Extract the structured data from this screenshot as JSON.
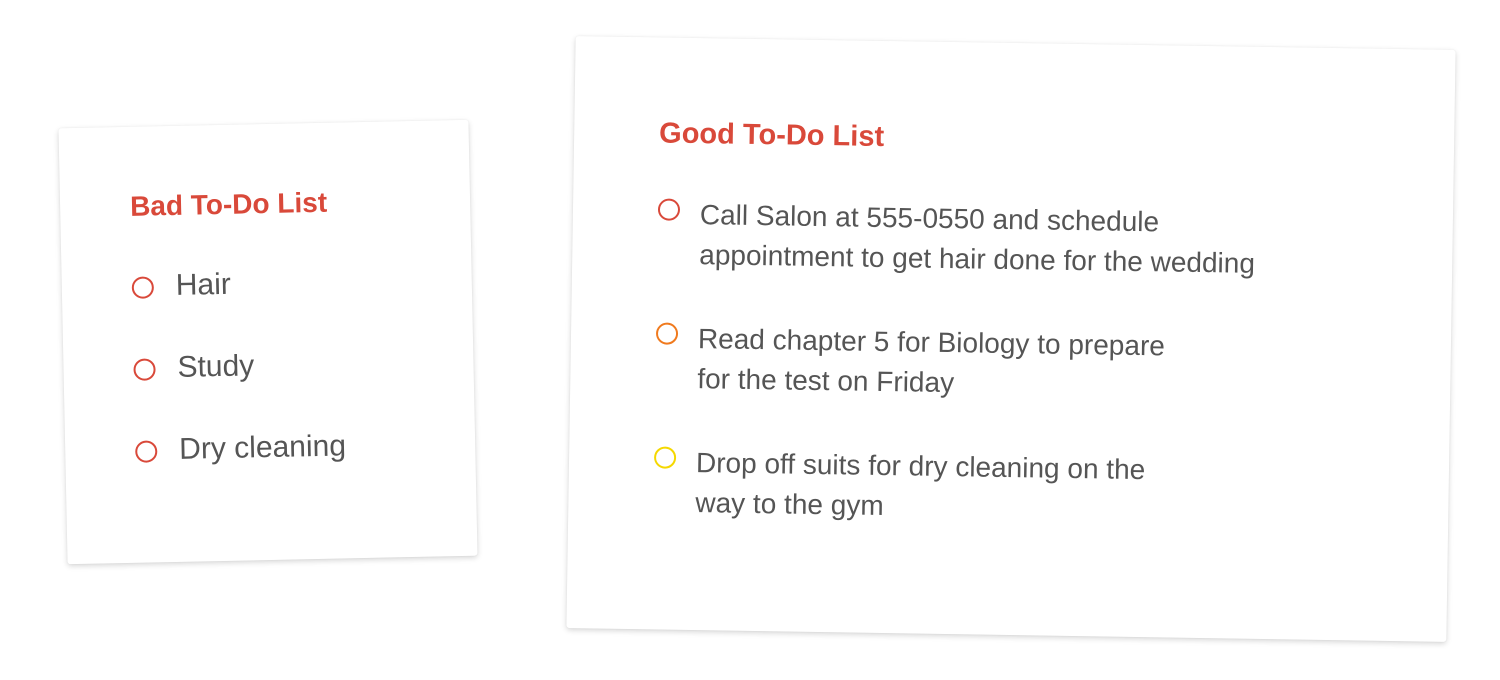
{
  "bad_list": {
    "title": "Bad To-Do List",
    "items": [
      {
        "text": "Hair",
        "circle_color": "#d9493a"
      },
      {
        "text": "Study",
        "circle_color": "#d9493a"
      },
      {
        "text": "Dry cleaning",
        "circle_color": "#d9493a"
      }
    ]
  },
  "good_list": {
    "title": "Good To-Do List",
    "items": [
      {
        "text": "Call Salon at 555-0550 and schedule\nappointment to get hair done for the wedding",
        "circle_color": "#d9493a"
      },
      {
        "text": "Read chapter 5 for Biology to prepare\nfor the test on Friday",
        "circle_color": "#f07a1e"
      },
      {
        "text": "Drop off suits for dry cleaning on the\nway to the gym",
        "circle_color": "#f5d800"
      }
    ]
  }
}
